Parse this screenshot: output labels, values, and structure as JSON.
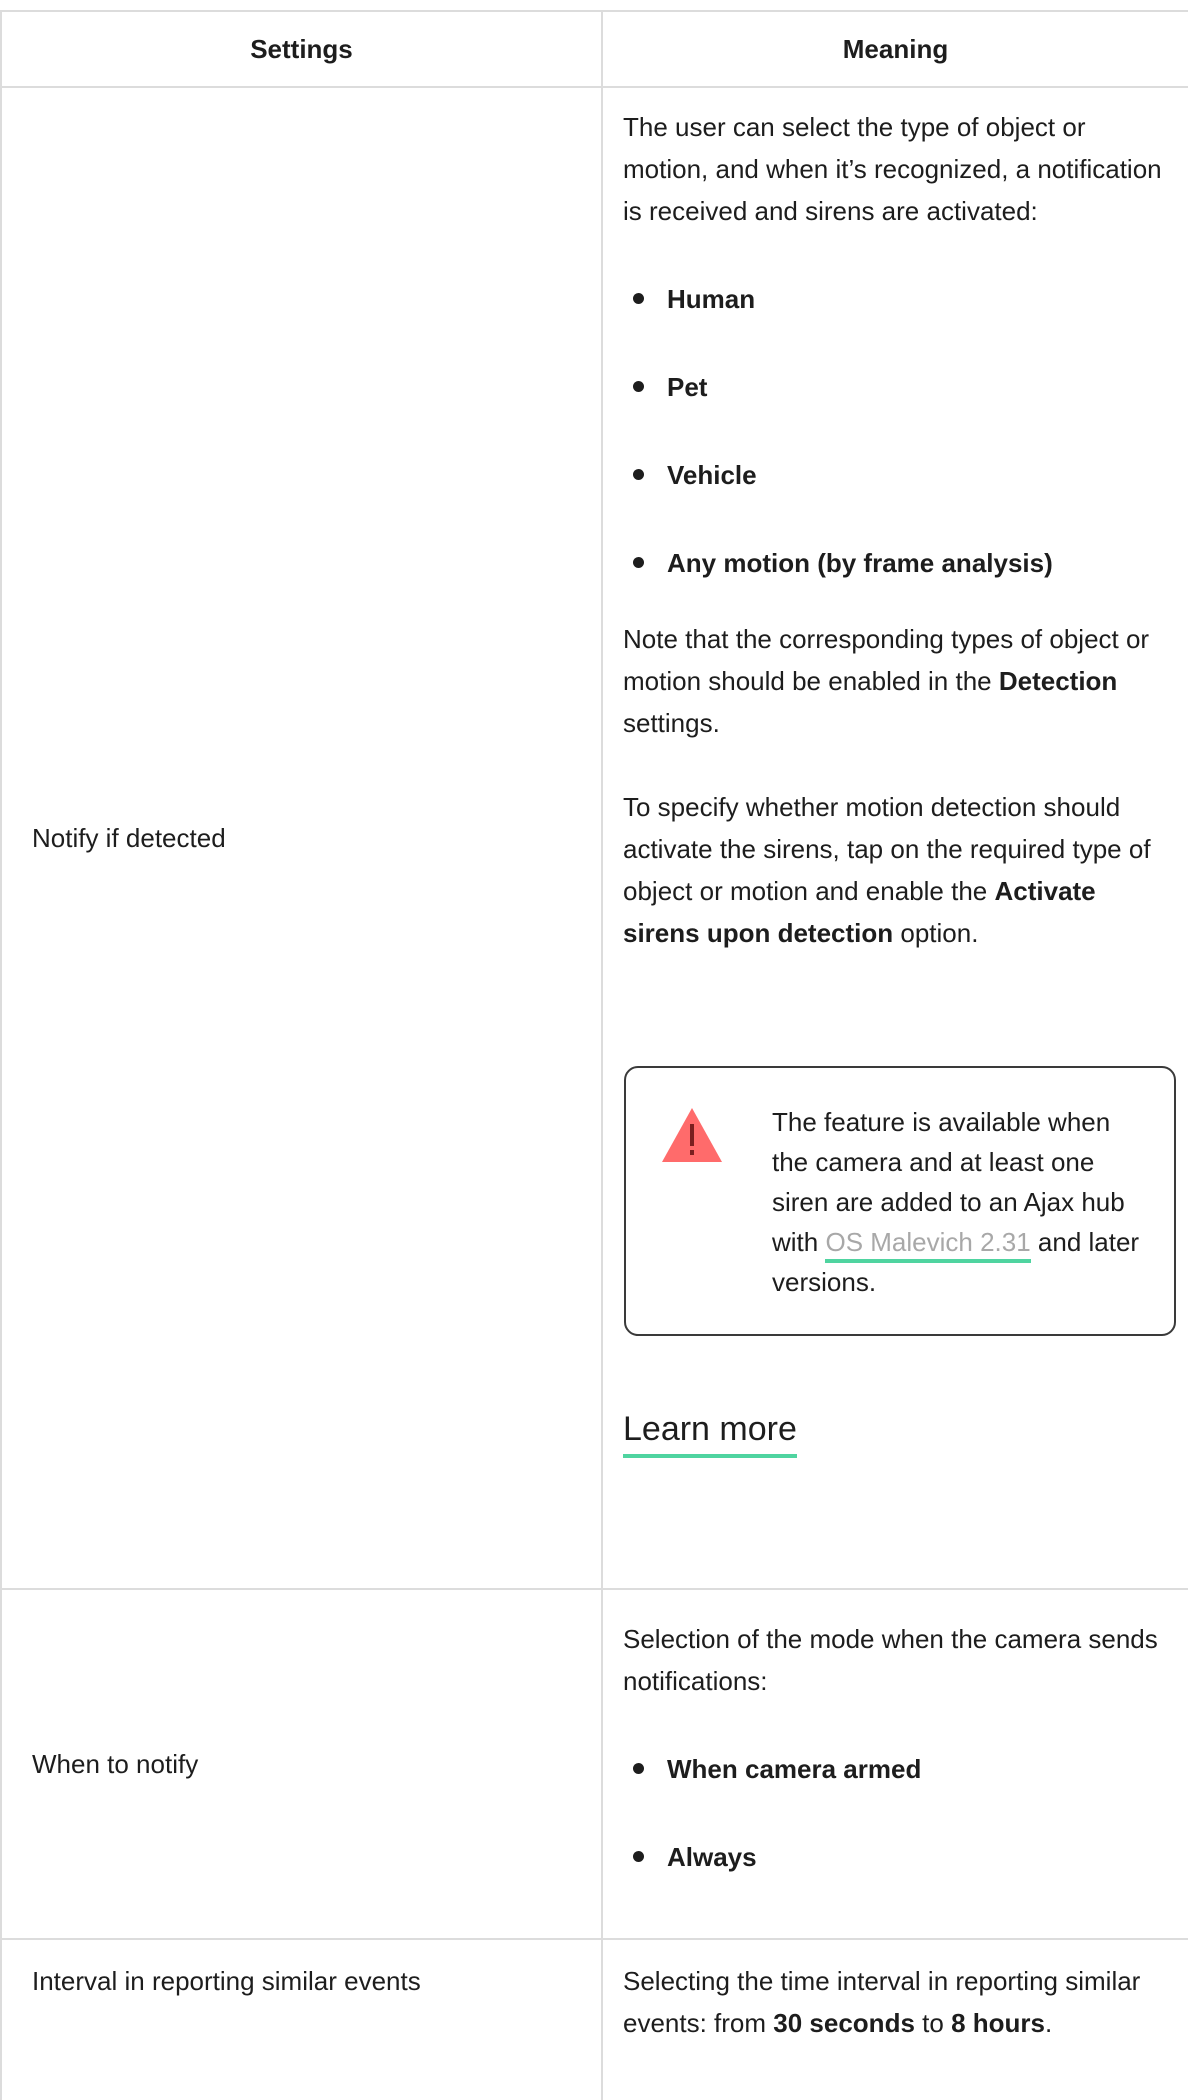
{
  "header": {
    "settings": "Settings",
    "meaning": "Meaning"
  },
  "rows": [
    {
      "setting": "Notify if detected",
      "intro": "The user can select the type of object or motion, and when it’s recognized, a notification is received and sirens are activated:",
      "bullets": [
        "Human",
        "Pet",
        "Vehicle",
        "Any motion (by frame analysis)"
      ],
      "note_pre": "Note that the corresponding types of object or motion should be enabled in the ",
      "note_bold": "Detection",
      "note_post": " settings.",
      "specify_pre": "To specify whether motion detection should activate the sirens, tap on the required type of object or motion and enable the ",
      "specify_bold": "Activate sirens upon detection",
      "specify_post": " option.",
      "callout": {
        "icon": "warning-icon",
        "text_pre": "The feature is available when the camera and at least one siren are added to an Ajax hub with ",
        "link": "OS Malevich 2.31",
        "text_post": " and later versions."
      },
      "learn_more": "Learn more"
    },
    {
      "setting": "When to notify",
      "intro": "Selection of the mode when the camera sends notifications:",
      "bullets": [
        "When camera armed",
        "Always"
      ]
    },
    {
      "setting": "Interval in reporting similar events",
      "text_pre": "Selecting the time interval in reporting similar events: from ",
      "bold1": "30 seconds",
      "mid": " to ",
      "bold2": "8 hours",
      "end": "."
    }
  ],
  "colors": {
    "accent_underline": "#4fd4a0",
    "warning": "#ff6b6b",
    "border": "#dcdcdc"
  }
}
